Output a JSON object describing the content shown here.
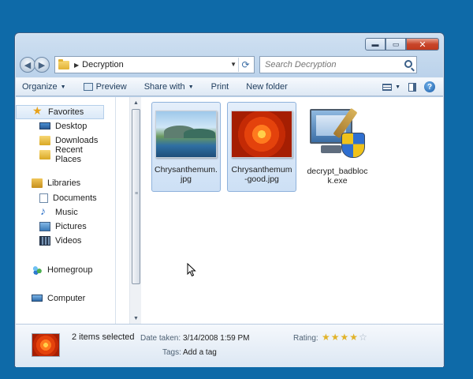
{
  "window": {
    "address": {
      "crumb": "Decryption"
    },
    "search": {
      "placeholder": "Search Decryption"
    }
  },
  "toolbar": {
    "organize": "Organize",
    "preview": "Preview",
    "share_with": "Share with",
    "print": "Print",
    "new_folder": "New folder"
  },
  "sidebar": {
    "favorites": "Favorites",
    "desktop": "Desktop",
    "downloads": "Downloads",
    "recent_places": "Recent Places",
    "libraries": "Libraries",
    "documents": "Documents",
    "music": "Music",
    "pictures": "Pictures",
    "videos": "Videos",
    "homegroup": "Homegroup",
    "computer": "Computer"
  },
  "files": [
    {
      "name": "Chrysanthemum.jpg",
      "line1": "Chrysanthemum.",
      "line2": "jpg",
      "selected": true
    },
    {
      "name": "Chrysanthemum-good.jpg",
      "line1": "Chrysanthemum",
      "line2": "-good.jpg",
      "selected": true
    },
    {
      "name": "decrypt_badblock.exe",
      "line1": "decrypt_badbloc",
      "line2": "k.exe",
      "selected": false
    }
  ],
  "details": {
    "summary": "2 items selected",
    "date_taken_label": "Date taken:",
    "date_taken_value": "3/14/2008 1:59 PM",
    "tags_label": "Tags:",
    "tags_value": "Add a tag",
    "rating_label": "Rating:",
    "rating": 4,
    "rating_max": 5
  },
  "colors": {
    "desktop_background": "#0e6aa8",
    "selection": "#cde0f5",
    "close_button": "#c8452a"
  }
}
